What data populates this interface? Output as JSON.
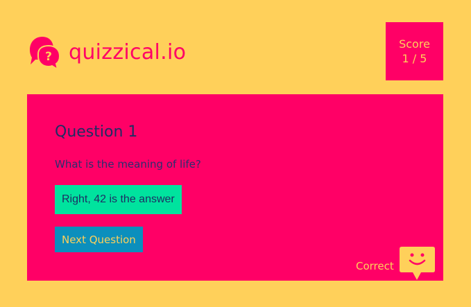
{
  "header": {
    "logo_icon": "speech-bubbles-question-icon",
    "brand": "quizzical.io"
  },
  "score": {
    "label": "Score",
    "value": "1 / 5"
  },
  "question": {
    "title": "Question 1",
    "text": "What is the meaning of life?",
    "answer_label": "Right, 42 is the answer",
    "next_label": "Next Question"
  },
  "feedback": {
    "text": "Correct",
    "icon": "smiley-speech-bubble-icon"
  },
  "colors": {
    "background": "#FFD05A",
    "accent": "#FF0066",
    "correct": "#00E39E",
    "next": "#0B8FBD",
    "text_dark": "#1E2D63"
  }
}
